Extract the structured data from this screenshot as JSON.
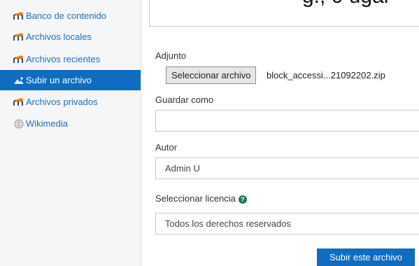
{
  "sidebar": {
    "items": [
      {
        "label": "Banco de contenido",
        "icon": "moodle-icon"
      },
      {
        "label": "Archivos locales",
        "icon": "moodle-icon"
      },
      {
        "label": "Archivos recientes",
        "icon": "moodle-icon"
      },
      {
        "label": "Subir un archivo",
        "icon": "upload-icon",
        "active": true
      },
      {
        "label": "Archivos privados",
        "icon": "moodle-icon"
      },
      {
        "label": "Wikimedia",
        "icon": "wikimedia-icon"
      }
    ]
  },
  "top_fragment": "g., 0 ugar",
  "form": {
    "attachment_label": "Adjunto",
    "choose_file_label": "Seleccionar archivo",
    "file_name": "block_accessi...21092202.zip",
    "save_as_label": "Guardar como",
    "save_as_value": "",
    "author_label": "Autor",
    "author_value": "Admin U",
    "license_label": "Seleccionar licencia",
    "license_value": "Todos los derechos reservados",
    "submit_label": "Subir este archivo"
  },
  "colors": {
    "accent": "#0f6cbf",
    "link": "#1f6fb4",
    "help": "#1f7a5a",
    "moodle_orange": "#f98012"
  }
}
